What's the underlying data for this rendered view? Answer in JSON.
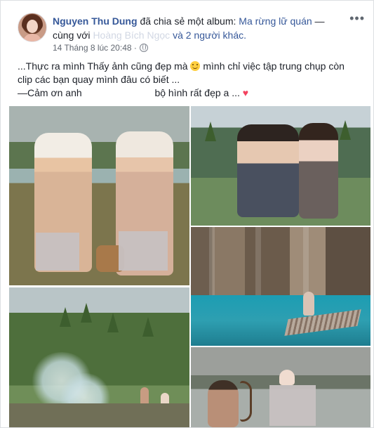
{
  "post": {
    "author": "Nguyen Thu Dung",
    "action": "đã chia sẻ một album:",
    "album": "Ma rừng lữ quán",
    "separator": "— cùng",
    "with_prefix": "với",
    "blurred_name": "Hoàng Bích Ngọc",
    "with_suffix": "và 2 người khác.",
    "timestamp": "14 Tháng 8 lúc 20:48 ·",
    "more_label": "•••",
    "caption_line1_prefix": "...Thực ra mình Thấy ảnh cũng đẹp mà",
    "caption_line1_suffix": "mình chỉ việc tập trung chụp còn",
    "caption_line2": "clip các bạn quay mình đâu có biết ...",
    "caption_line3_prefix": "—Cảm ơn anh",
    "caption_line3_suffix": "bộ hình rất đẹp a ...",
    "heart": "♥"
  },
  "icons": {
    "globe": "globe-icon",
    "more": "more-icon",
    "smile": "smile-emoji",
    "heart": "heart-icon"
  }
}
